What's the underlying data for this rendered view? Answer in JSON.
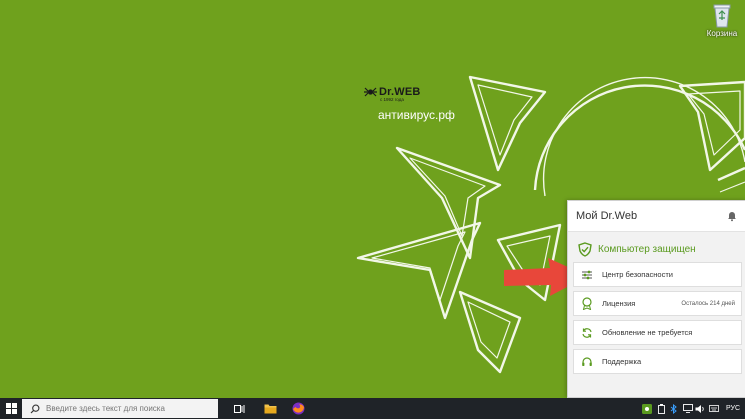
{
  "desktop": {
    "recycle_bin": {
      "label": "Корзина",
      "icon": "recycle-bin-icon"
    },
    "logo": {
      "brand": "Dr.WEB",
      "since": "с 1992 года",
      "site": "антивирус.рф"
    }
  },
  "panel": {
    "title": "Мой Dr.Web",
    "status": "Компьютер защищен",
    "items": [
      {
        "label": "Центр безопасности",
        "extra": ""
      },
      {
        "label": "Лицензия",
        "extra": "Осталось 214 дней"
      },
      {
        "label": "Обновление не требуется",
        "extra": ""
      },
      {
        "label": "Поддержка",
        "extra": ""
      }
    ],
    "colors": {
      "accent": "#5a9a1f",
      "arrow": "#e8473a"
    }
  },
  "taskbar": {
    "search_placeholder": "Введите здесь текст для поиска",
    "language": "РУС"
  },
  "colors": {
    "background": "#6fa11d",
    "taskbar": "#1f2328"
  }
}
